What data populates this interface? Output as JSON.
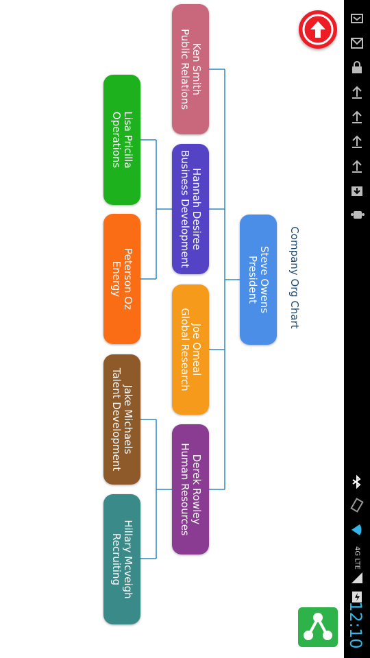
{
  "chart": {
    "title": "Company Org Chart",
    "nodes": [
      {
        "name": "Steve Owens",
        "role": "President",
        "color": "#4a8ee8"
      },
      {
        "name": "Ken Smith",
        "role": "Public Relations",
        "color": "#c9687d"
      },
      {
        "name": "Hannah Desiree",
        "role": "Business Development",
        "color": "#5444c5"
      },
      {
        "name": "Joe Omeal",
        "role": "Global Research",
        "color": "#f59a1a"
      },
      {
        "name": "Derek Rowley",
        "role": "Human Resources",
        "color": "#8a3c93"
      },
      {
        "name": "Lisa Pricilla",
        "role": "Operations",
        "color": "#1db21d"
      },
      {
        "name": "Peterson Oz",
        "role": "Energy",
        "color": "#fa6d14"
      },
      {
        "name": "Jake Michaels",
        "role": "Talent Development",
        "color": "#8e5a2a"
      },
      {
        "name": "Hillary Mcveigh",
        "role": "Recruiting",
        "color": "#3a8a8a"
      }
    ]
  },
  "status_bar": {
    "time": "12:10",
    "network": "4G LTE",
    "icons": [
      "mail-icon",
      "gmail-icon",
      "lock-icon",
      "upload-icon",
      "upload-icon",
      "upload-icon",
      "upload-icon",
      "download-icon",
      "android-icon",
      "bluetooth-icon",
      "vibrate-icon",
      "wifi-icon",
      "signal-icon",
      "battery-icon"
    ]
  },
  "actions": {
    "fab_icon": "arrow-up-icon",
    "app_icon": "org-chart-app-icon"
  }
}
